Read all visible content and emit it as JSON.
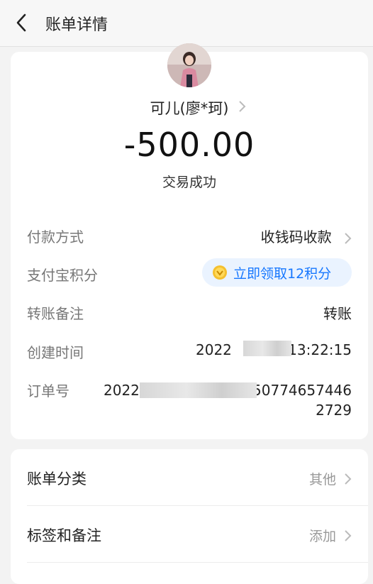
{
  "header": {
    "title": "账单详情"
  },
  "bill": {
    "payee": "可儿(廖*珂)",
    "amount": "-500.00",
    "status": "交易成功"
  },
  "details": {
    "payment_method_label": "付款方式",
    "payment_method_value": "收钱码收款",
    "points_label": "支付宝积分",
    "points_value": "立即领取12积分",
    "note_label": "转账备注",
    "note_value": "转账",
    "created_label": "创建时间",
    "created_prefix": "2022",
    "created_suffix": "13:22:15",
    "order_label": "订单号",
    "order_prefix": "2022",
    "order_suffix": "50774657446",
    "order_line2": "2729"
  },
  "actions": {
    "category_label": "账单分类",
    "category_value": "其他",
    "tags_label": "标签和备注",
    "tags_value": "添加"
  },
  "colors": {
    "accent": "#1677ff",
    "points_bg": "#eaf3ff",
    "badge": "#f5c02f"
  }
}
